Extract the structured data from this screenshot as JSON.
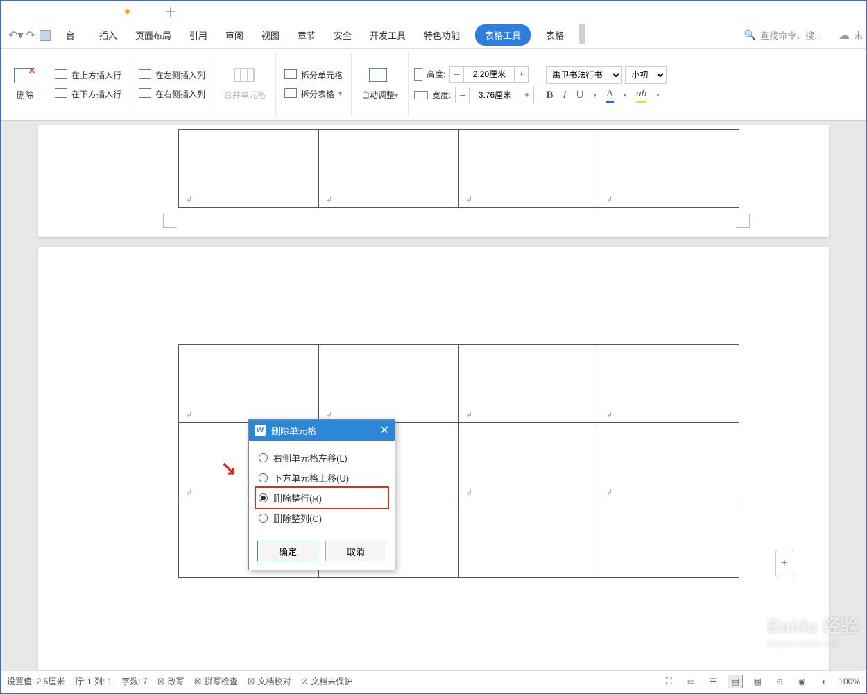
{
  "menu": {
    "tabs": [
      "台",
      "插入",
      "页面布局",
      "引用",
      "审阅",
      "视图",
      "章节",
      "安全",
      "开发工具",
      "特色功能",
      "表格工具",
      "表格"
    ],
    "active_index": 10,
    "search_placeholder": "查找命令、搜..."
  },
  "ribbon": {
    "delete": "删除",
    "insert_row_above": "在上方插入行",
    "insert_row_below": "在下方插入行",
    "insert_col_left": "在左侧插入列",
    "insert_col_right": "在右侧插入列",
    "merge_cells": "合并单元格",
    "split_cells": "拆分单元格",
    "split_table": "拆分表格",
    "autofit": "自动调整",
    "height_label": "高度:",
    "width_label": "宽度:",
    "height_value": "2.20厘米",
    "width_value": "3.76厘米",
    "font_name": "禹卫书法行书",
    "font_size": "小初",
    "bold": "B",
    "italic": "I",
    "underline": "U",
    "font_color": "A",
    "highlight": "ab"
  },
  "dialog": {
    "title": "删除单元格",
    "options": [
      {
        "label": "右侧单元格左移(L)",
        "checked": false
      },
      {
        "label": "下方单元格上移(U)",
        "checked": false
      },
      {
        "label": "删除整行(R)",
        "checked": true,
        "highlighted": true
      },
      {
        "label": "删除整列(C)",
        "checked": false
      }
    ],
    "ok": "确定",
    "cancel": "取消"
  },
  "statusbar": {
    "position": "设置值: 2.5厘米",
    "row_col": "行: 1  列: 1",
    "word_count": "字数: 7",
    "revise": "改写",
    "spellcheck": "拼写检查",
    "proofread": "文档校对",
    "protection": "文档未保护",
    "zoom": "100%"
  },
  "watermark": {
    "main": "Baidu 经验",
    "sub": "jingyan.baidu.com"
  },
  "cell_mark": "↲"
}
